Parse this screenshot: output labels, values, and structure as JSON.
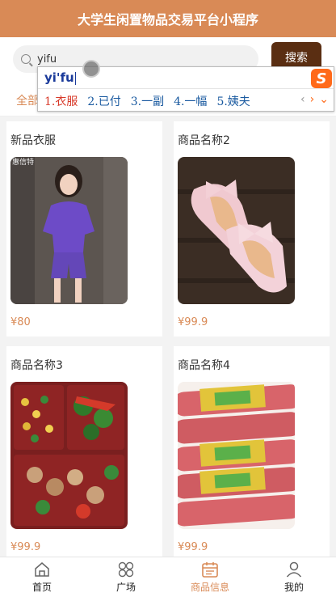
{
  "header": {
    "title": "大学生闲置物品交易平台小程序"
  },
  "search": {
    "value": "yifu",
    "button_label": "搜索"
  },
  "categories": {
    "active": "全部"
  },
  "ime": {
    "composition": "yi'fu",
    "candidates": [
      "1.衣服",
      "2.已付",
      "3.一副",
      "4.一幅",
      "5.姨夫"
    ],
    "logo": "S",
    "prev": "‹",
    "next": "›",
    "expand": "⌄"
  },
  "products": [
    {
      "name": "新品衣服",
      "price": "¥80",
      "watermark": "惠信特"
    },
    {
      "name": "商品名称2",
      "price": "¥99.9"
    },
    {
      "name": "商品名称3",
      "price": "¥99.9"
    },
    {
      "name": "商品名称4",
      "price": "¥99.9"
    }
  ],
  "tabbar": {
    "active_color": "#d98a56",
    "items": [
      {
        "label": "首页",
        "icon": "home-icon"
      },
      {
        "label": "广场",
        "icon": "grid-icon"
      },
      {
        "label": "商品信息",
        "icon": "calendar-icon"
      },
      {
        "label": "我的",
        "icon": "person-icon"
      }
    ]
  }
}
